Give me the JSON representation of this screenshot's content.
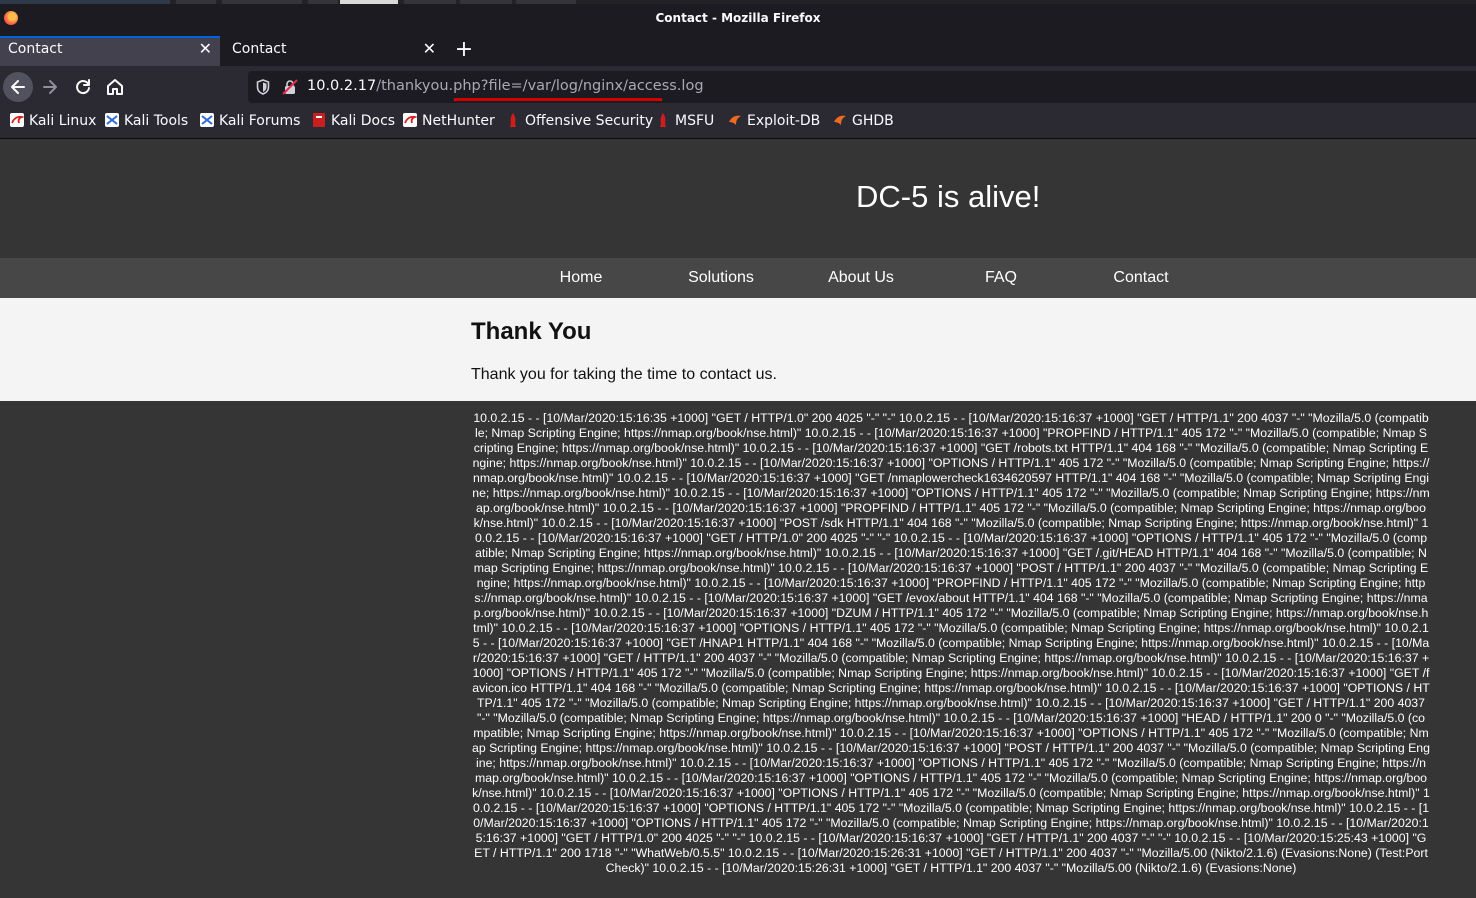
{
  "window": {
    "title": "Contact - Mozilla Firefox"
  },
  "tabs": [
    {
      "label": "Contact",
      "active": true
    },
    {
      "label": "Contact",
      "active": false
    }
  ],
  "urlbar": {
    "host": "10.0.2.17",
    "path": "/thankyou.php?file=/var/log/nginx/access.log"
  },
  "bookmarks": [
    {
      "label": "Kali Linux",
      "icon": "kali-dragon-icon"
    },
    {
      "label": "Kali Tools",
      "icon": "kali-tools-icon"
    },
    {
      "label": "Kali Forums",
      "icon": "kali-forums-icon"
    },
    {
      "label": "Kali Docs",
      "icon": "kali-docs-icon"
    },
    {
      "label": "NetHunter",
      "icon": "nethunter-icon"
    },
    {
      "label": "Offensive Security",
      "icon": "offsec-icon"
    },
    {
      "label": "MSFU",
      "icon": "msfu-icon"
    },
    {
      "label": "Exploit-DB",
      "icon": "exploit-db-icon"
    },
    {
      "label": "GHDB",
      "icon": "ghdb-icon"
    }
  ],
  "site": {
    "title": "DC-5 is alive!",
    "nav": [
      "Home",
      "Solutions",
      "About Us",
      "FAQ",
      "Contact"
    ],
    "heading": "Thank You",
    "message": "Thank you for taking the time to contact us.",
    "log": "10.0.2.15 - - [10/Mar/2020:15:16:35 +1000] \"GET / HTTP/1.0\" 200 4025 \"-\" \"-\" 10.0.2.15 - - [10/Mar/2020:15:16:37 +1000] \"GET / HTTP/1.1\" 200 4037 \"-\" \"Mozilla/5.0 (compatible; Nmap Scripting Engine; https://nmap.org/book/nse.html)\" 10.0.2.15 - - [10/Mar/2020:15:16:37 +1000] \"PROPFIND / HTTP/1.1\" 405 172 \"-\" \"Mozilla/5.0 (compatible; Nmap Scripting Engine; https://nmap.org/book/nse.html)\" 10.0.2.15 - - [10/Mar/2020:15:16:37 +1000] \"GET /robots.txt HTTP/1.1\" 404 168 \"-\" \"Mozilla/5.0 (compatible; Nmap Scripting Engine; https://nmap.org/book/nse.html)\" 10.0.2.15 - - [10/Mar/2020:15:16:37 +1000] \"OPTIONS / HTTP/1.1\" 405 172 \"-\" \"Mozilla/5.0 (compatible; Nmap Scripting Engine; https://nmap.org/book/nse.html)\" 10.0.2.15 - - [10/Mar/2020:15:16:37 +1000] \"GET /nmaplowercheck1634620597 HTTP/1.1\" 404 168 \"-\" \"Mozilla/5.0 (compatible; Nmap Scripting Engine; https://nmap.org/book/nse.html)\" 10.0.2.15 - - [10/Mar/2020:15:16:37 +1000] \"OPTIONS / HTTP/1.1\" 405 172 \"-\" \"Mozilla/5.0 (compatible; Nmap Scripting Engine; https://nmap.org/book/nse.html)\" 10.0.2.15 - - [10/Mar/2020:15:16:37 +1000] \"PROPFIND / HTTP/1.1\" 405 172 \"-\" \"Mozilla/5.0 (compatible; Nmap Scripting Engine; https://nmap.org/book/nse.html)\" 10.0.2.15 - - [10/Mar/2020:15:16:37 +1000] \"POST /sdk HTTP/1.1\" 404 168 \"-\" \"Mozilla/5.0 (compatible; Nmap Scripting Engine; https://nmap.org/book/nse.html)\" 10.0.2.15 - - [10/Mar/2020:15:16:37 +1000] \"GET / HTTP/1.0\" 200 4025 \"-\" \"-\" 10.0.2.15 - - [10/Mar/2020:15:16:37 +1000] \"OPTIONS / HTTP/1.1\" 405 172 \"-\" \"Mozilla/5.0 (compatible; Nmap Scripting Engine; https://nmap.org/book/nse.html)\" 10.0.2.15 - - [10/Mar/2020:15:16:37 +1000] \"GET /.git/HEAD HTTP/1.1\" 404 168 \"-\" \"Mozilla/5.0 (compatible; Nmap Scripting Engine; https://nmap.org/book/nse.html)\" 10.0.2.15 - - [10/Mar/2020:15:16:37 +1000] \"POST / HTTP/1.1\" 200 4037 \"-\" \"Mozilla/5.0 (compatible; Nmap Scripting Engine; https://nmap.org/book/nse.html)\" 10.0.2.15 - - [10/Mar/2020:15:16:37 +1000] \"PROPFIND / HTTP/1.1\" 405 172 \"-\" \"Mozilla/5.0 (compatible; Nmap Scripting Engine; https://nmap.org/book/nse.html)\" 10.0.2.15 - - [10/Mar/2020:15:16:37 +1000] \"GET /evox/about HTTP/1.1\" 404 168 \"-\" \"Mozilla/5.0 (compatible; Nmap Scripting Engine; https://nmap.org/book/nse.html)\" 10.0.2.15 - - [10/Mar/2020:15:16:37 +1000] \"DZUM / HTTP/1.1\" 405 172 \"-\" \"Mozilla/5.0 (compatible; Nmap Scripting Engine; https://nmap.org/book/nse.html)\" 10.0.2.15 - - [10/Mar/2020:15:16:37 +1000] \"OPTIONS / HTTP/1.1\" 405 172 \"-\" \"Mozilla/5.0 (compatible; Nmap Scripting Engine; https://nmap.org/book/nse.html)\" 10.0.2.15 - - [10/Mar/2020:15:16:37 +1000] \"GET /HNAP1 HTTP/1.1\" 404 168 \"-\" \"Mozilla/5.0 (compatible; Nmap Scripting Engine; https://nmap.org/book/nse.html)\" 10.0.2.15 - - [10/Mar/2020:15:16:37 +1000] \"GET / HTTP/1.1\" 200 4037 \"-\" \"Mozilla/5.0 (compatible; Nmap Scripting Engine; https://nmap.org/book/nse.html)\" 10.0.2.15 - - [10/Mar/2020:15:16:37 +1000] \"OPTIONS / HTTP/1.1\" 405 172 \"-\" \"Mozilla/5.0 (compatible; Nmap Scripting Engine; https://nmap.org/book/nse.html)\" 10.0.2.15 - - [10/Mar/2020:15:16:37 +1000] \"GET /favicon.ico HTTP/1.1\" 404 168 \"-\" \"Mozilla/5.0 (compatible; Nmap Scripting Engine; https://nmap.org/book/nse.html)\" 10.0.2.15 - - [10/Mar/2020:15:16:37 +1000] \"OPTIONS / HTTP/1.1\" 405 172 \"-\" \"Mozilla/5.0 (compatible; Nmap Scripting Engine; https://nmap.org/book/nse.html)\" 10.0.2.15 - - [10/Mar/2020:15:16:37 +1000] \"GET / HTTP/1.1\" 200 4037 \"-\" \"Mozilla/5.0 (compatible; Nmap Scripting Engine; https://nmap.org/book/nse.html)\" 10.0.2.15 - - [10/Mar/2020:15:16:37 +1000] \"HEAD / HTTP/1.1\" 200 0 \"-\" \"Mozilla/5.0 (compatible; Nmap Scripting Engine; https://nmap.org/book/nse.html)\" 10.0.2.15 - - [10/Mar/2020:15:16:37 +1000] \"OPTIONS / HTTP/1.1\" 405 172 \"-\" \"Mozilla/5.0 (compatible; Nmap Scripting Engine; https://nmap.org/book/nse.html)\" 10.0.2.15 - - [10/Mar/2020:15:16:37 +1000] \"POST / HTTP/1.1\" 200 4037 \"-\" \"Mozilla/5.0 (compatible; Nmap Scripting Engine; https://nmap.org/book/nse.html)\" 10.0.2.15 - - [10/Mar/2020:15:16:37 +1000] \"OPTIONS / HTTP/1.1\" 405 172 \"-\" \"Mozilla/5.0 (compatible; Nmap Scripting Engine; https://nmap.org/book/nse.html)\" 10.0.2.15 - - [10/Mar/2020:15:16:37 +1000] \"OPTIONS / HTTP/1.1\" 405 172 \"-\" \"Mozilla/5.0 (compatible; Nmap Scripting Engine; https://nmap.org/book/nse.html)\" 10.0.2.15 - - [10/Mar/2020:15:16:37 +1000] \"OPTIONS / HTTP/1.1\" 405 172 \"-\" \"Mozilla/5.0 (compatible; Nmap Scripting Engine; https://nmap.org/book/nse.html)\" 10.0.2.15 - - [10/Mar/2020:15:16:37 +1000] \"OPTIONS / HTTP/1.1\" 405 172 \"-\" \"Mozilla/5.0 (compatible; Nmap Scripting Engine; https://nmap.org/book/nse.html)\" 10.0.2.15 - - [10/Mar/2020:15:16:37 +1000] \"OPTIONS / HTTP/1.1\" 405 172 \"-\" \"Mozilla/5.0 (compatible; Nmap Scripting Engine; https://nmap.org/book/nse.html)\" 10.0.2.15 - - [10/Mar/2020:15:16:37 +1000] \"GET / HTTP/1.0\" 200 4025 \"-\" \"-\" 10.0.2.15 - - [10/Mar/2020:15:16:37 +1000] \"GET / HTTP/1.1\" 200 4037 \"-\" \"-\" 10.0.2.15 - - [10/Mar/2020:15:25:43 +1000] \"GET / HTTP/1.1\" 200 1718 \"-\" \"WhatWeb/0.5.5\" 10.0.2.15 - - [10/Mar/2020:15:26:31 +1000] \"GET / HTTP/1.1\" 200 4037 \"-\" \"Mozilla/5.00 (Nikto/2.1.6) (Evasions:None) (Test:Port Check)\" 10.0.2.15 - - [10/Mar/2020:15:26:31 +1000] \"GET / HTTP/1.1\" 200 4037 \"-\" \"Mozilla/5.00 (Nikto/2.1.6) (Evasions:None)"
  }
}
